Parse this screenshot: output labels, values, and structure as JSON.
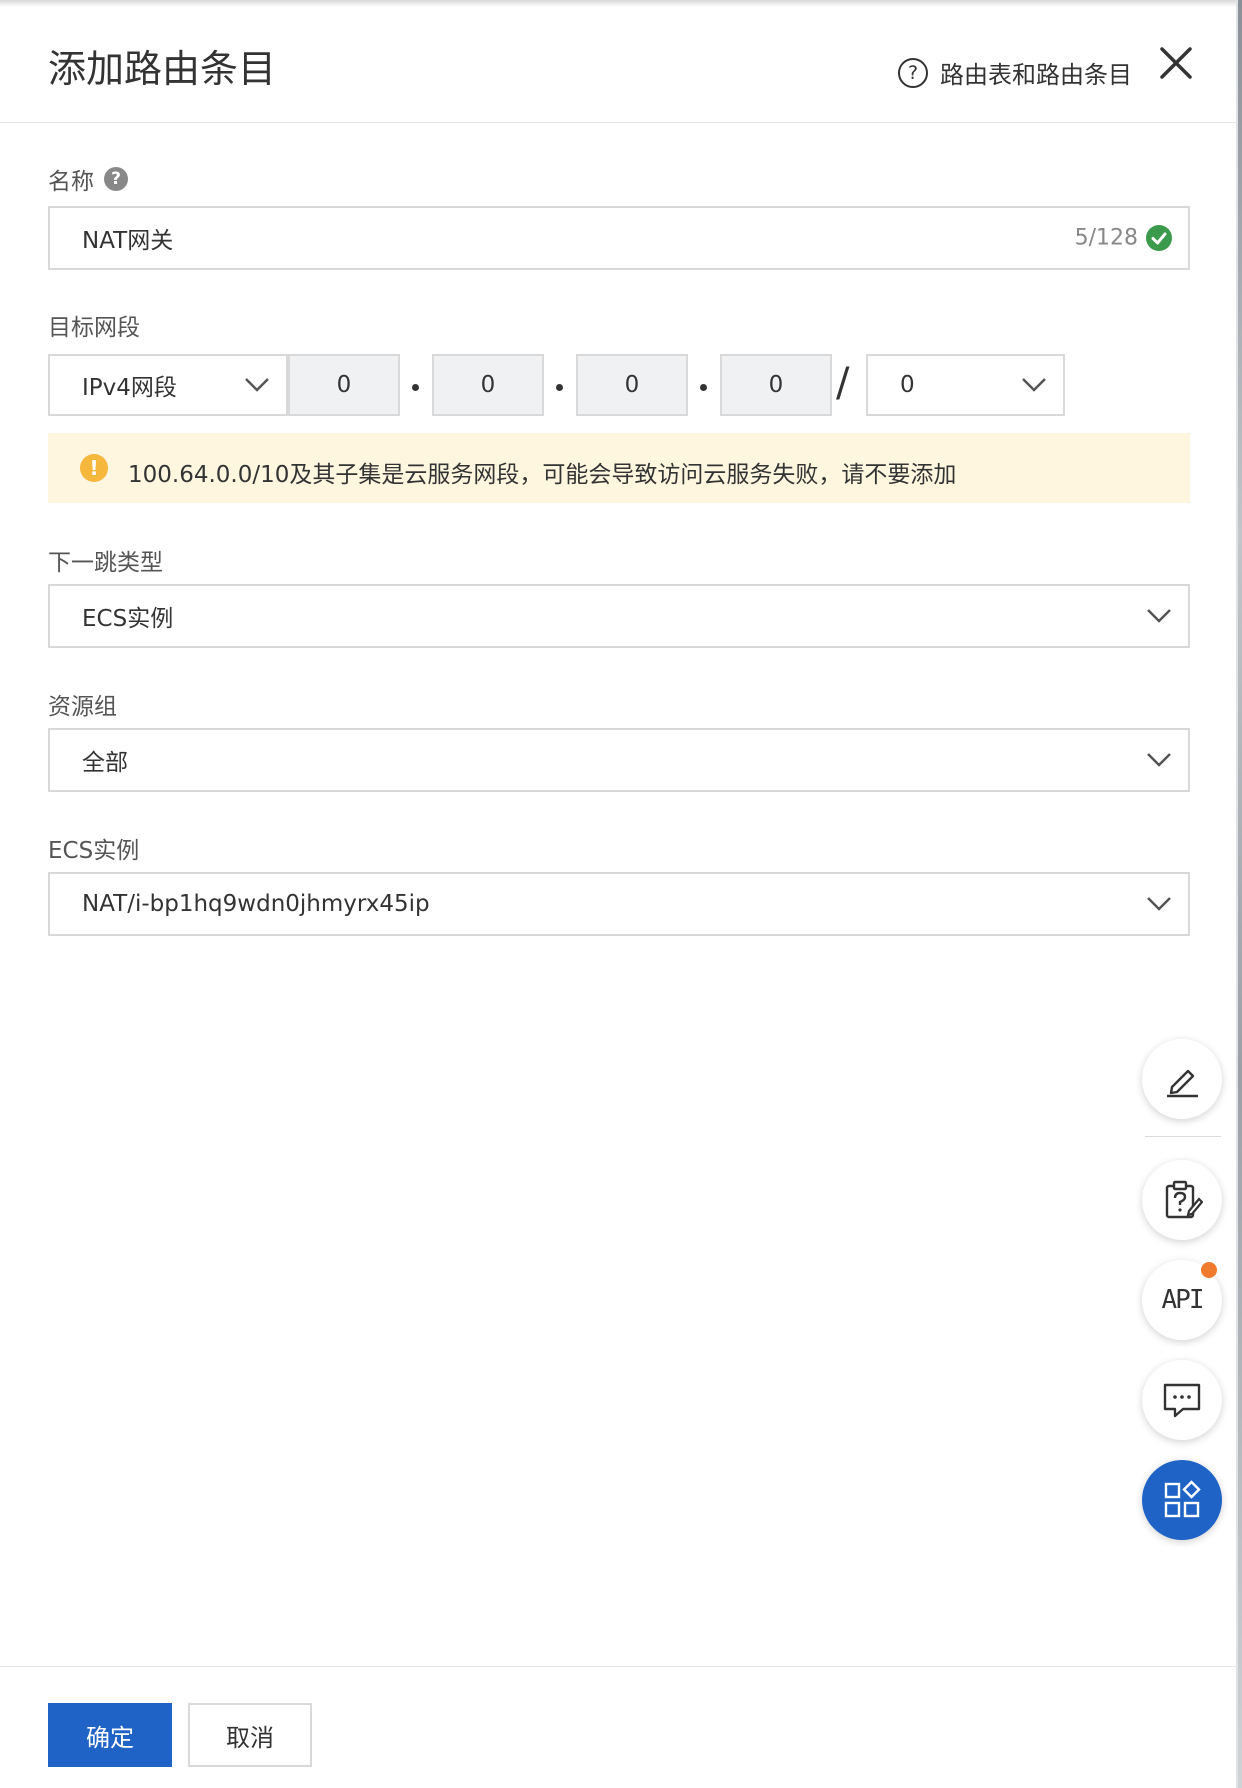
{
  "dialog": {
    "title": "添加路由条目",
    "help_link": "路由表和路由条目",
    "help_icon_glyph": "?"
  },
  "form": {
    "name": {
      "label": "名称",
      "value": "NAT网关",
      "counter": "5/128"
    },
    "target_cidr": {
      "label": "目标网段",
      "type_select": "IPv4网段",
      "octets": [
        "0",
        "0",
        "0",
        "0"
      ],
      "mask": "0",
      "slash": "/"
    },
    "warning": {
      "icon_glyph": "!",
      "text": "100.64.0.0/10及其子集是云服务网段，可能会导致访问云服务失败，请不要添加"
    },
    "next_hop_type": {
      "label": "下一跳类型",
      "value": "ECS实例"
    },
    "resource_group": {
      "label": "资源组",
      "value": "全部"
    },
    "ecs_instance": {
      "label": "ECS实例",
      "value": "NAT/i-bp1hq9wdn0jhmyrx45ip"
    }
  },
  "floating_tools": {
    "api_label": "API",
    "icons": [
      "edit-icon",
      "clipboard-question-icon",
      "api-icon",
      "chat-icon",
      "apps-icon"
    ]
  },
  "footer": {
    "confirm": "确定",
    "cancel": "取消"
  },
  "colors": {
    "primary": "#1f63c6",
    "warning_bg": "#fff6e0",
    "warning_icon": "#f5b73c",
    "success": "#3b9a4b",
    "notification": "#f07a2e"
  }
}
